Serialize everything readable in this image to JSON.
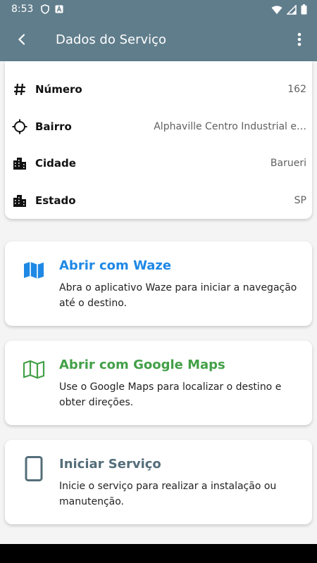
{
  "status_bar": {
    "time": "8:53"
  },
  "app_bar": {
    "title": "Dados do Serviço"
  },
  "details": [
    {
      "label": "Número",
      "value": "162",
      "icon": "hash-icon"
    },
    {
      "label": "Bairro",
      "value": "Alphaville Centro Industrial e…",
      "icon": "location-target-icon"
    },
    {
      "label": "Cidade",
      "value": "Barueri",
      "icon": "city-icon"
    },
    {
      "label": "Estado",
      "value": "SP",
      "icon": "city-icon"
    }
  ],
  "actions": [
    {
      "title": "Abrir com Waze",
      "description": "Abra o aplicativo Waze para iniciar a navegação até o destino.",
      "color": "#1e88e5",
      "icon": "map-icon"
    },
    {
      "title": "Abrir com Google Maps",
      "description": "Use o Google Maps para localizar o destino e obter direções.",
      "color": "#43a047",
      "icon": "map-outline-icon"
    },
    {
      "title": "Iniciar Serviço",
      "description": "Inicie o serviço para realizar a instalação ou manutenção.",
      "color": "#546e7a",
      "icon": "phone-icon"
    }
  ],
  "colors": {
    "app_bar": "#607d8b",
    "background": "#f4f4f4"
  }
}
